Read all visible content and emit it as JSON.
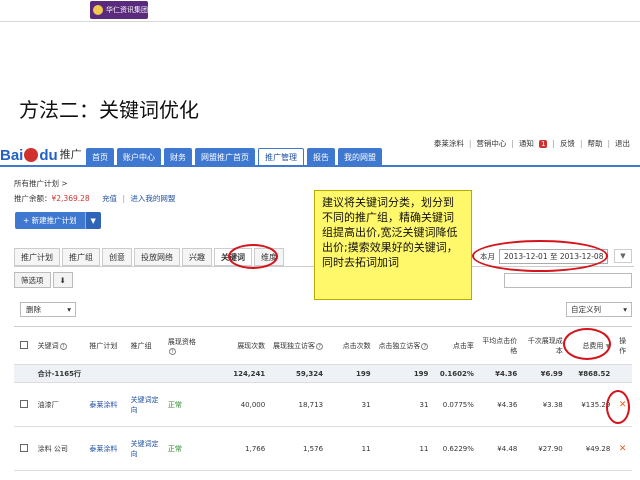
{
  "slide": {
    "logo_text": "华仁资讯集团",
    "title": "方法二：关键词优化"
  },
  "header": {
    "brand_bai": "Bai",
    "brand_du": "du",
    "brand_product": "推广",
    "username": "泰莱涂料",
    "links": [
      "营销中心",
      "通知",
      "反馈",
      "帮助",
      "退出"
    ],
    "notice_count": "1"
  },
  "nav": {
    "tabs": [
      "首页",
      "账户中心",
      "财务",
      "网盟推广首页",
      "推广管理",
      "报告",
      "我的网盟"
    ],
    "active_index": 4
  },
  "breadcrumb": "所有推广计划 >",
  "balance": {
    "label": "推广余额：",
    "amount": "¥2,369.28",
    "recharge": "充值",
    "sep": "|",
    "link": "进入我的网盟"
  },
  "new_plan_button": "+ 新建推广计划",
  "subtabs": {
    "items": [
      "推广计划",
      "推广组",
      "创意",
      "投放网络",
      "兴趣",
      "关键词",
      "维度"
    ],
    "active_index": 5
  },
  "date_range": {
    "period": "本月",
    "start": "2013-12-01",
    "to": "至",
    "end": "2013-12-08"
  },
  "filter": {
    "button": "筛选项"
  },
  "toolbar": {
    "delete_label": "删除",
    "custom_columns_label": "自定义列"
  },
  "callout": "建议将关键词分类，划分到不同的推广组，精确关键词组提高出价,宽泛关键词降低出价;摸索效果好的关键词，同时去拓词加词",
  "table": {
    "headers": [
      "关键词",
      "推广计划",
      "推广组",
      "展现资格",
      "展现次数",
      "展现独立访客",
      "点击次数",
      "点击独立访客",
      "点击率",
      "平均点击价格",
      "千次展现成本",
      "总费用",
      "操作"
    ],
    "total": {
      "label": "合计-1165行",
      "impressions": "124,241",
      "unique_visitors": "59,324",
      "clicks": "199",
      "unique_clicks": "199",
      "ctr": "0.1602%",
      "avg_cpc": "¥4.36",
      "cpm": "¥6.99",
      "cost": "¥868.52"
    },
    "rows": [
      {
        "keyword": "油漆厂",
        "plan": "泰莱涂料",
        "group": "关键词定向",
        "status": "正常",
        "impressions": "40,000",
        "unique_visitors": "18,713",
        "clicks": "31",
        "unique_clicks": "31",
        "ctr": "0.0775%",
        "avg_cpc": "¥4.36",
        "cpm": "¥3.38",
        "cost": "¥135.29",
        "action": "✕"
      },
      {
        "keyword": "涂料 公司",
        "plan": "泰莱涂料",
        "group": "关键词定向",
        "status": "正常",
        "impressions": "1,766",
        "unique_visitors": "1,576",
        "clicks": "11",
        "unique_clicks": "11",
        "ctr": "0.6229%",
        "avg_cpc": "¥4.48",
        "cpm": "¥27.90",
        "cost": "¥49.28",
        "action": "✕"
      }
    ]
  },
  "colors": {
    "nav_blue": "#3f78d1",
    "annotation_red": "#d4131a",
    "callout_yellow": "#fff86a"
  }
}
